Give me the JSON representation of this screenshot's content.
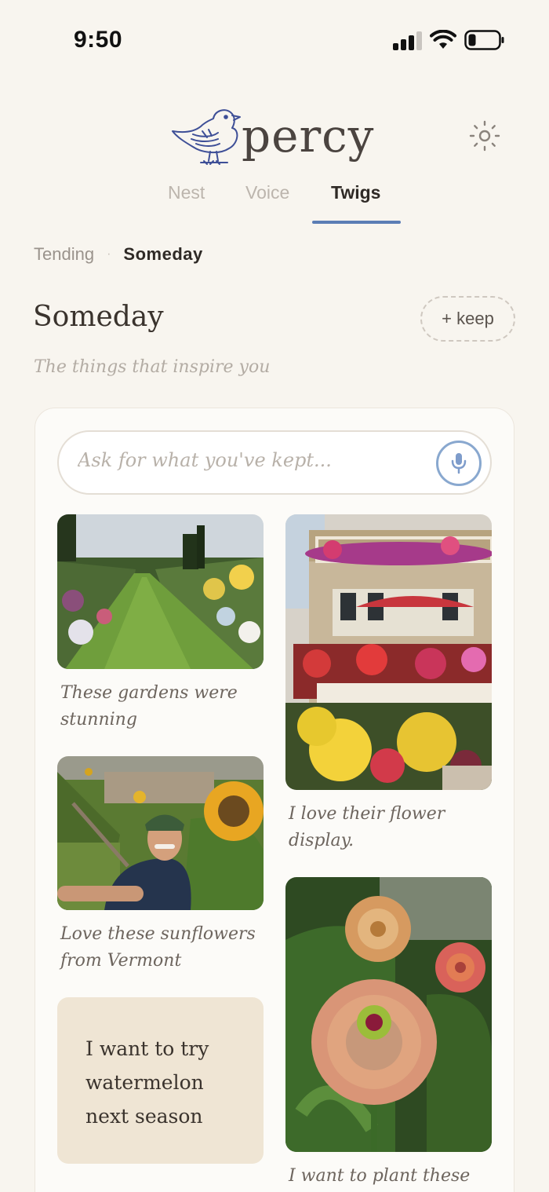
{
  "status_bar": {
    "time": "9:50",
    "signal_icon": "cellular-signal-icon",
    "wifi_icon": "wifi-icon",
    "battery_icon": "battery-low-icon"
  },
  "header": {
    "logo_text": "percy",
    "logo_icon": "bird-icon",
    "settings_icon": "sun-settings-icon"
  },
  "tabs": [
    {
      "label": "Nest",
      "active": false
    },
    {
      "label": "Voice",
      "active": false
    },
    {
      "label": "Twigs",
      "active": true
    }
  ],
  "subnav": {
    "items": [
      "Tending",
      "Someday"
    ],
    "active": "Someday",
    "separator": "·"
  },
  "section": {
    "title": "Someday",
    "tagline": "The things that inspire you",
    "keep_button": "+ keep"
  },
  "search": {
    "placeholder": "Ask for what you've kept...",
    "mic_icon": "microphone-icon"
  },
  "items": [
    {
      "type": "photo",
      "subject": "garden-path",
      "caption": "These gardens were stunning"
    },
    {
      "type": "photo",
      "subject": "flower-balcony",
      "caption": "I love their flower display."
    },
    {
      "type": "photo",
      "subject": "sunflower-selfie",
      "caption": "Love these sunflowers from Vermont"
    },
    {
      "type": "photo",
      "subject": "zinnias",
      "caption": "I want to plant these"
    },
    {
      "type": "note",
      "text": "I want to try watermelon next season"
    }
  ],
  "colors": {
    "background": "#f8f5ef",
    "accent": "#5b7db5",
    "mic": "#89a8cf",
    "note": "#efe5d4"
  }
}
